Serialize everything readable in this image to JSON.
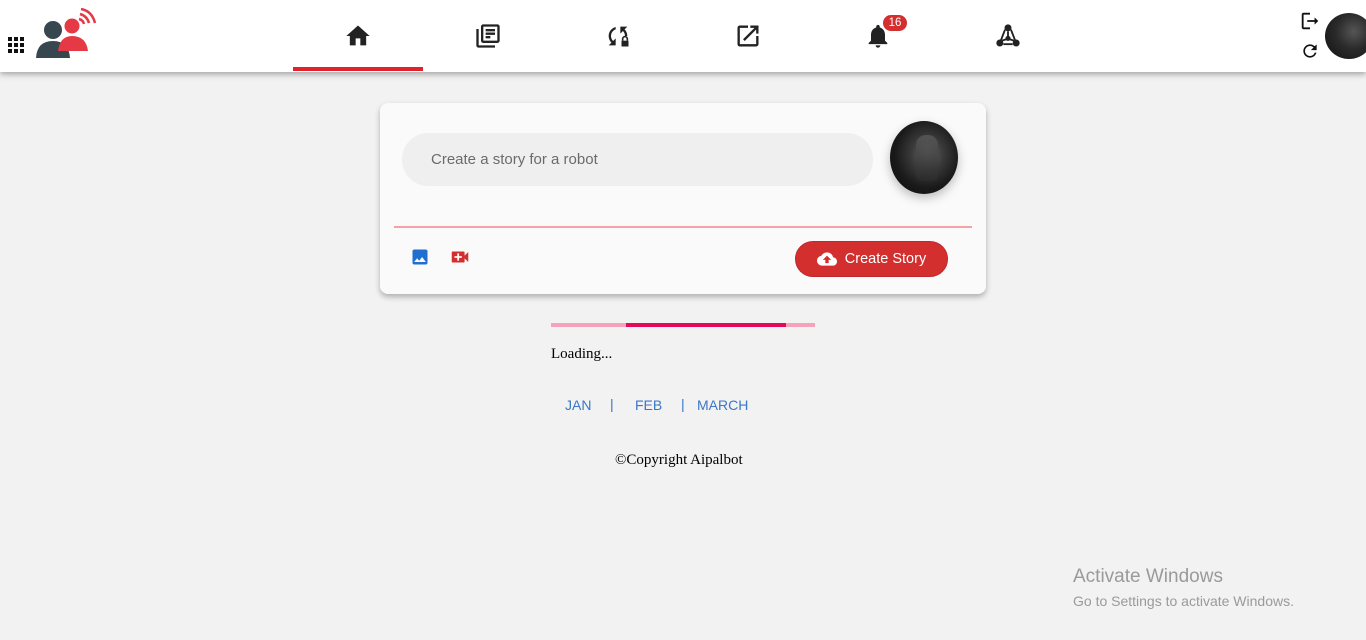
{
  "colors": {
    "accent": "#e1222a",
    "button": "#d32f2f",
    "progress_track": "#f8a1bb",
    "progress_fill": "#e5095a",
    "link": "#3a77c5"
  },
  "header": {
    "apps_icon": "apps-grid-icon",
    "logo_icon": "aipalbot-logo",
    "tabs": [
      {
        "icon": "home-icon",
        "active": true
      },
      {
        "icon": "library-icon",
        "active": false
      },
      {
        "icon": "sync-lock-icon",
        "active": false
      },
      {
        "icon": "open-in-new-icon",
        "active": false
      },
      {
        "icon": "notifications-icon",
        "active": false,
        "badge": "16"
      },
      {
        "icon": "network-icon",
        "active": false
      }
    ],
    "logout_icon": "logout-icon",
    "refresh_icon": "refresh-icon"
  },
  "story": {
    "placeholder": "Create a story for a robot",
    "image_icon": "image-icon",
    "video_icon": "video-camera-icon",
    "create_label": "Create Story",
    "create_icon": "cloud-upload-icon"
  },
  "progress": {
    "fraction": 0.61
  },
  "loading_text": "Loading...",
  "months": [
    "JAN",
    "FEB",
    "MARCH"
  ],
  "months_separator": "|",
  "copyright": "©Copyright Aipalbot",
  "watermark": {
    "title": "Activate Windows",
    "subtitle": "Go to Settings to activate Windows."
  }
}
